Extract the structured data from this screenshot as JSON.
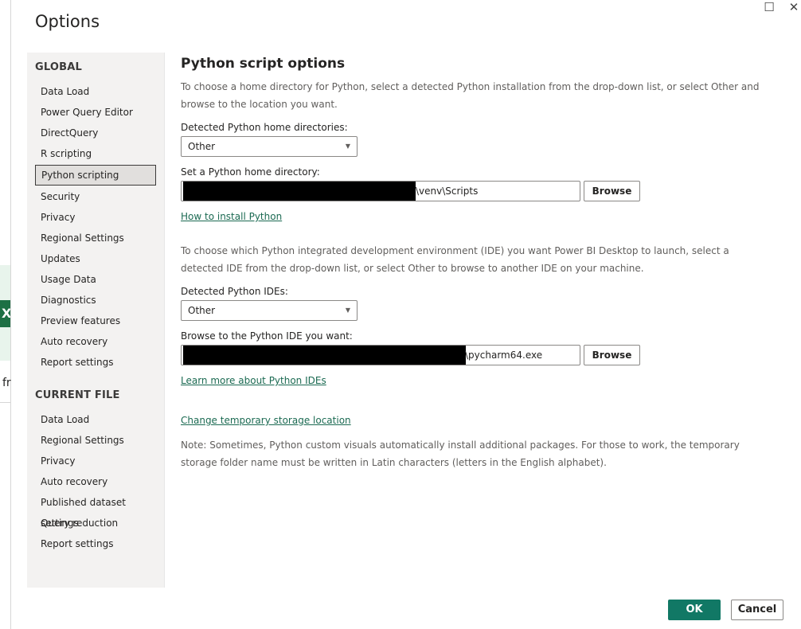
{
  "dialog": {
    "title": "Options"
  },
  "window_controls": {
    "maximize": "☐",
    "close": "✕"
  },
  "background": {
    "excel_icon": "X",
    "text_fragment": "fr"
  },
  "sidebar": {
    "global_header": "GLOBAL",
    "global_items": [
      {
        "label": "Data Load"
      },
      {
        "label": "Power Query Editor"
      },
      {
        "label": "DirectQuery"
      },
      {
        "label": "R scripting"
      },
      {
        "label": "Python scripting",
        "active": true
      },
      {
        "label": "Security"
      },
      {
        "label": "Privacy"
      },
      {
        "label": "Regional Settings"
      },
      {
        "label": "Updates"
      },
      {
        "label": "Usage Data"
      },
      {
        "label": "Diagnostics"
      },
      {
        "label": "Preview features"
      },
      {
        "label": "Auto recovery"
      },
      {
        "label": "Report settings"
      }
    ],
    "current_header": "CURRENT FILE",
    "current_items": [
      {
        "label": "Data Load"
      },
      {
        "label": "Regional Settings"
      },
      {
        "label": "Privacy"
      },
      {
        "label": "Auto recovery"
      },
      {
        "label": "Published dataset settings"
      },
      {
        "label": "Query reduction"
      },
      {
        "label": "Report settings"
      }
    ]
  },
  "content": {
    "title": "Python script options",
    "home_intro": "To choose a home directory for Python, select a detected Python installation from the drop-down list, or select Other and browse to the location you want.",
    "detected_home_label": "Detected Python home directories:",
    "detected_home_value": "Other",
    "set_home_label": "Set a Python home directory:",
    "home_dir_value": "\\venv\\Scripts",
    "browse_label": "Browse",
    "install_link": "How to install Python",
    "ide_intro": "To choose which Python integrated development environment (IDE) you want Power BI Desktop to launch, select a detected IDE from the drop-down list, or select Other to browse to another IDE on your machine.",
    "detected_ide_label": "Detected Python IDEs:",
    "detected_ide_value": "Other",
    "browse_ide_label": "Browse to the Python IDE you want:",
    "ide_path_value": "\\pycharm64.exe",
    "browse_ide_button": "Browse",
    "ide_link": "Learn more about Python IDEs",
    "storage_link": "Change temporary storage location",
    "note": "Note: Sometimes, Python custom visuals automatically install additional packages. For those to work, the temporary storage folder name must be written in Latin characters (letters in the English alphabet)."
  },
  "footer": {
    "ok": "OK",
    "cancel": "Cancel"
  },
  "colors": {
    "accent": "#117865",
    "link": "#1b6a52",
    "sidebar_bg": "#f3f2f1"
  }
}
